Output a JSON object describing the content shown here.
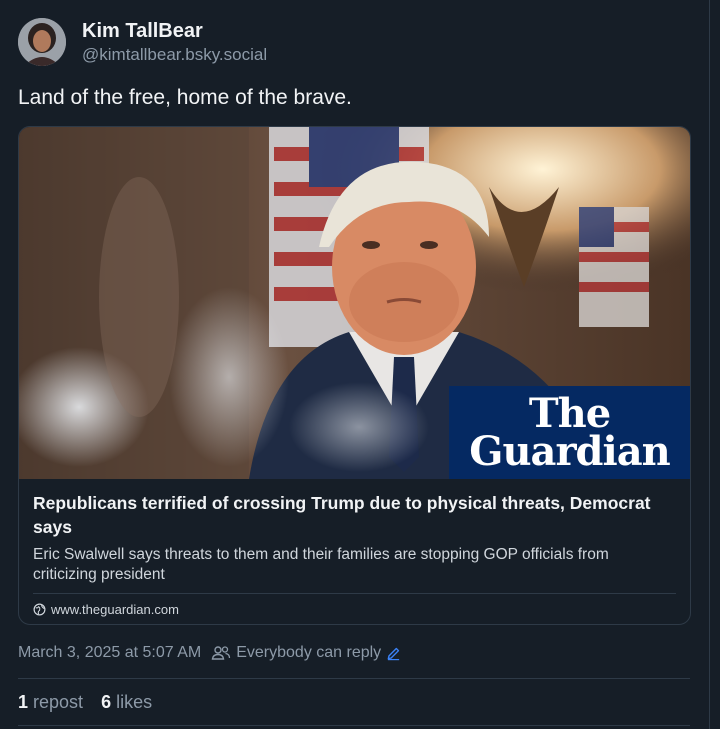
{
  "author": {
    "display_name": "Kim TallBear",
    "handle": "@kimtallbear.bsky.social"
  },
  "post": {
    "text": "Land of the free, home of the brave."
  },
  "link_card": {
    "image_logo_line1": "The",
    "image_logo_line2": "Guardian",
    "title": "Republicans terrified of crossing Trump due to physical threats, Democrat says",
    "description": "Eric Swalwell says threats to them and their families are stopping GOP officials from criticizing president",
    "domain": "www.theguardian.com"
  },
  "meta": {
    "timestamp": "March 3, 2025 at 5:07 AM",
    "reply_setting": "Everybody can reply"
  },
  "engagement": {
    "repost_count": "1",
    "repost_label": "repost",
    "like_count": "6",
    "like_label": "likes"
  },
  "colors": {
    "background": "#161e27",
    "guardian_blue": "#052962"
  }
}
